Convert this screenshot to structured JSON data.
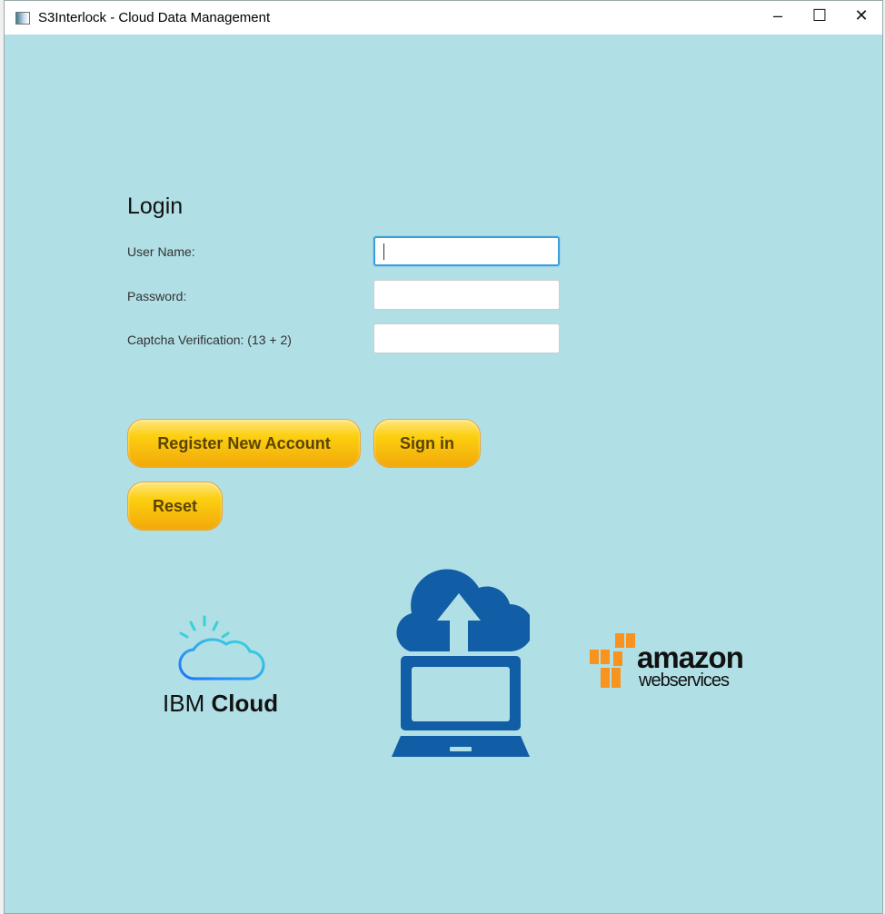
{
  "window": {
    "title": "S3Interlock - Cloud Data Management",
    "minimize": "–",
    "maximize": "☐",
    "close": "✕"
  },
  "login": {
    "heading": "Login",
    "username_label": "User Name:",
    "username_value": "",
    "password_label": "Password:",
    "password_value": "",
    "captcha_label": "Captcha Verification: (13 + 2)",
    "captcha_value": ""
  },
  "buttons": {
    "register": "Register New Account",
    "sign_in": "Sign in",
    "reset": "Reset"
  },
  "logos": {
    "ibm_prefix": "IBM",
    "ibm_suffix": "Cloud",
    "aws_main": "amazon",
    "aws_sub": "webservices"
  },
  "colors": {
    "background": "#b0dfe5",
    "button": "#fccf10",
    "cloud_icon": "#115ea6",
    "aws_orange": "#f7931e"
  }
}
